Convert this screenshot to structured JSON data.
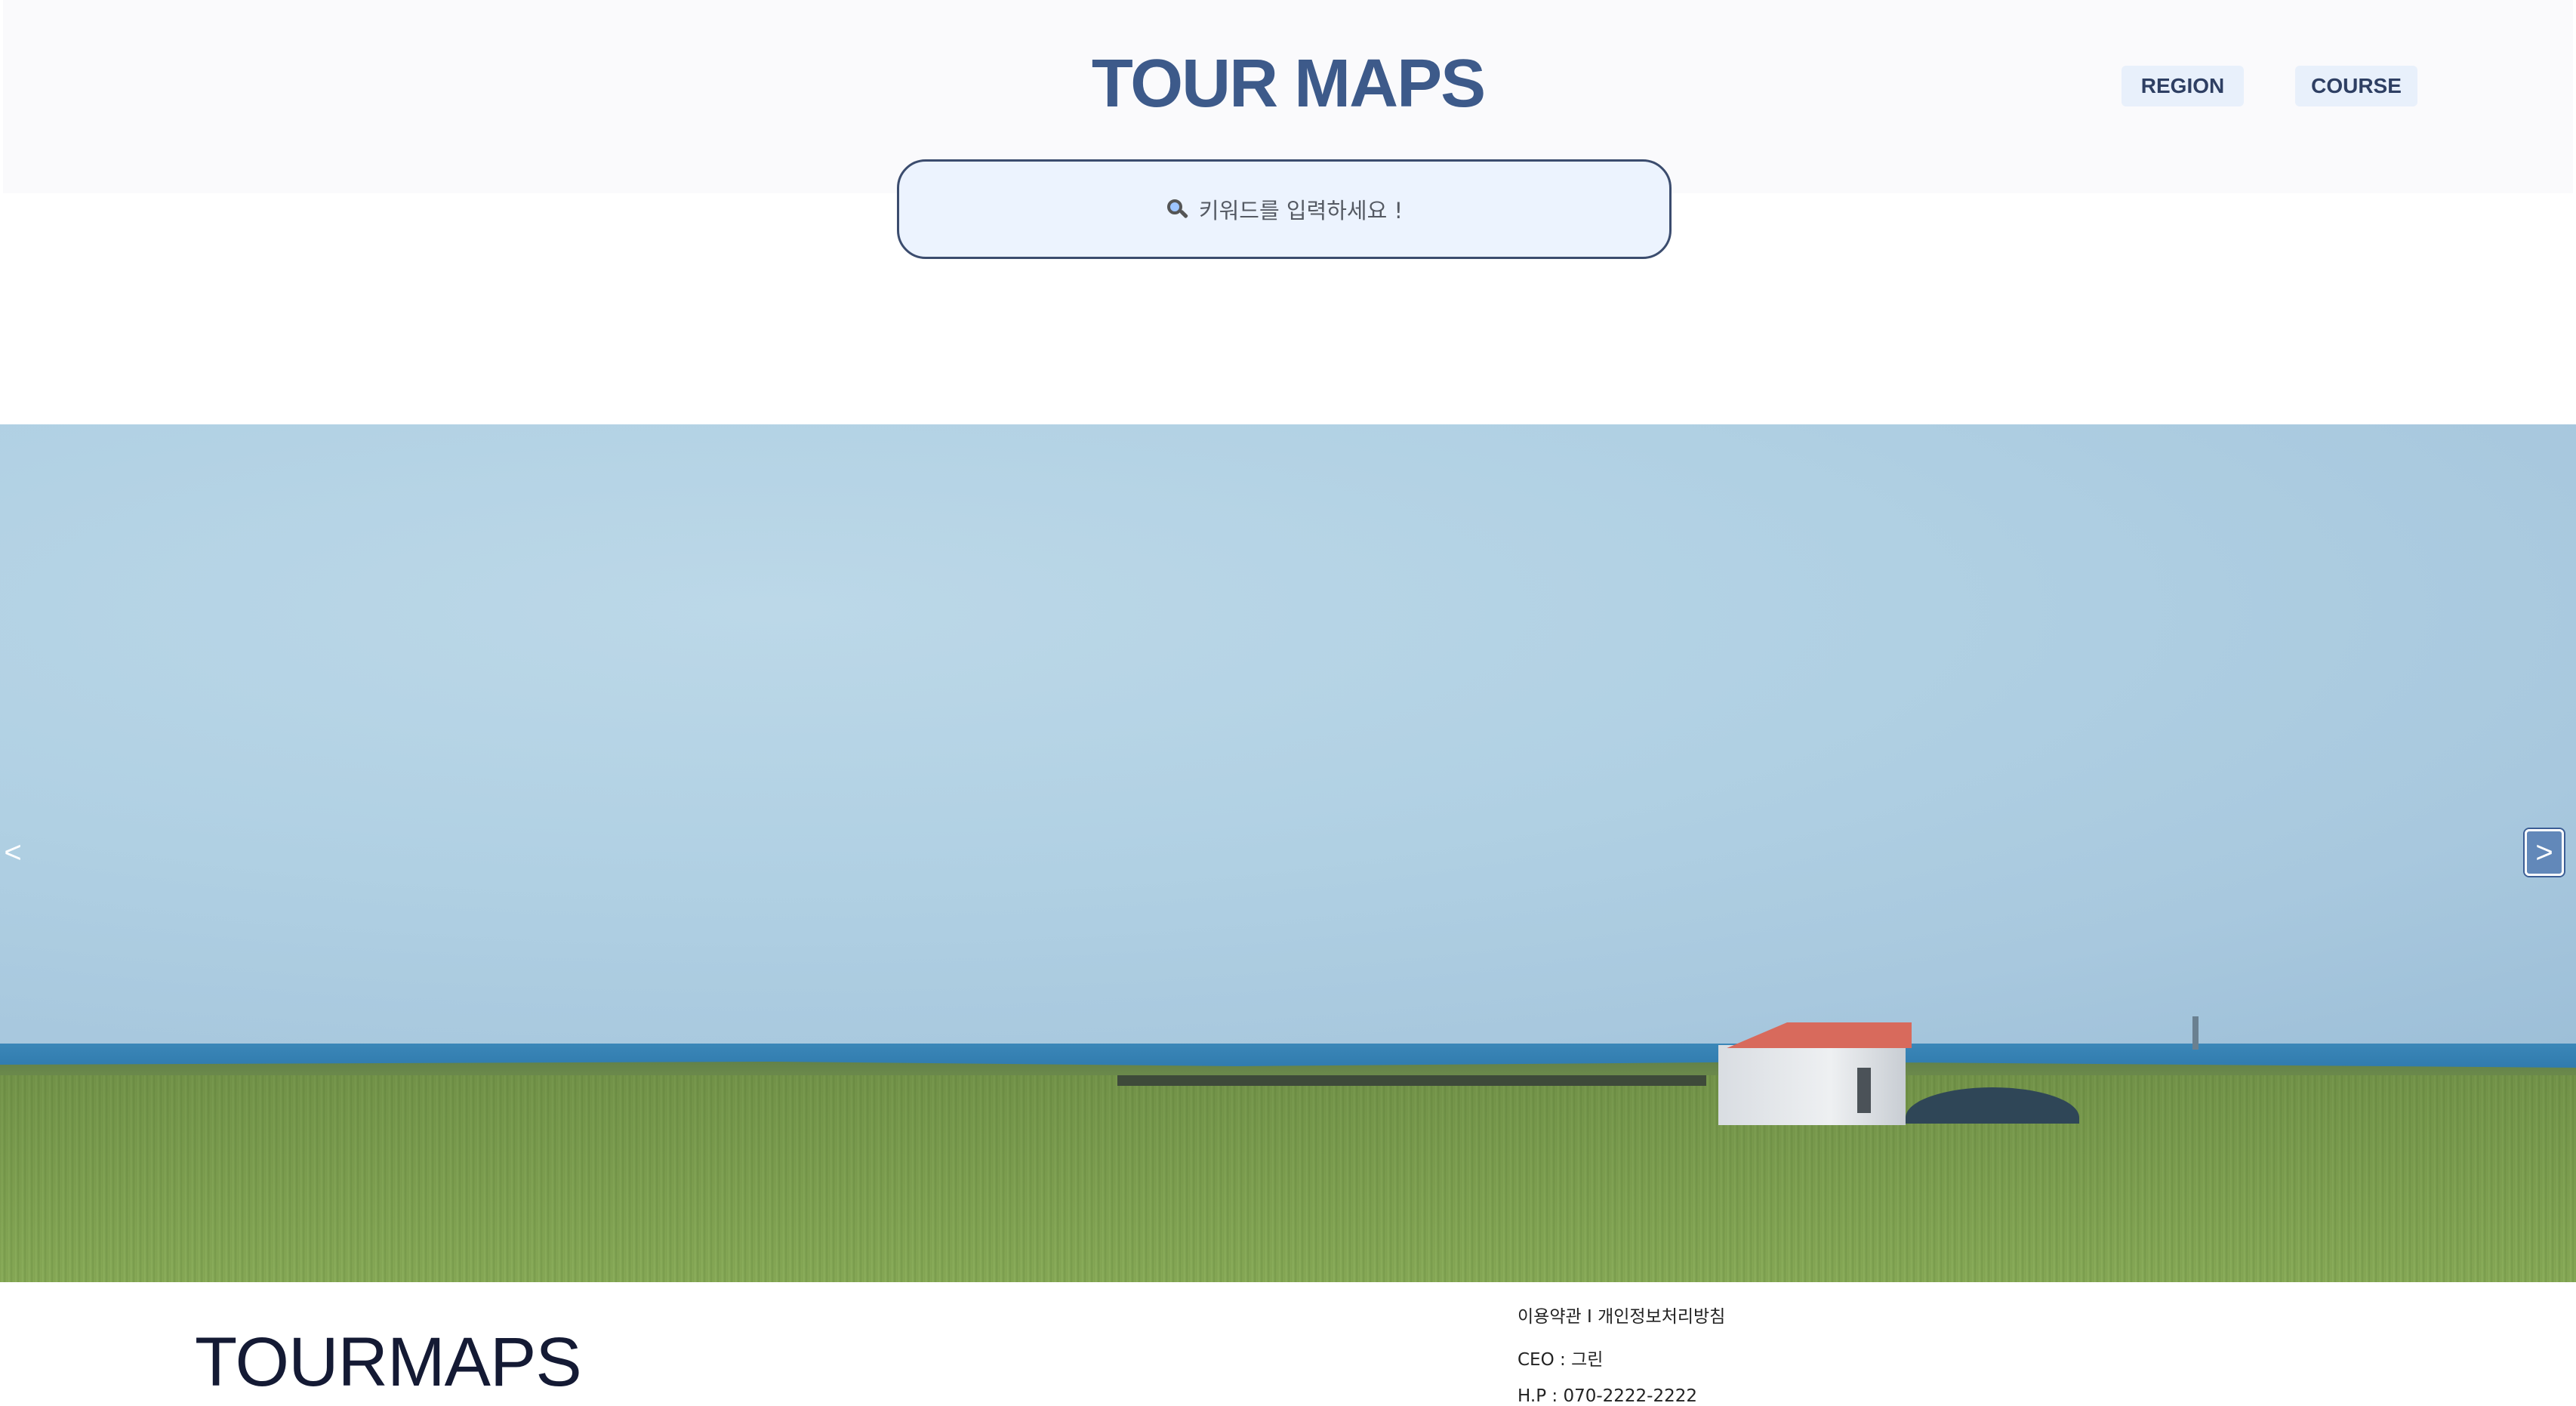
{
  "header": {
    "logo": "TOUR MAPS",
    "nav": {
      "region_label": "REGION",
      "course_label": "COURSE"
    }
  },
  "search": {
    "icon": "search-icon",
    "placeholder": "키워드를 입력하세요 !"
  },
  "hero": {
    "prev_label": "<",
    "next_label": ">"
  },
  "footer": {
    "logo": "TOURMAPS",
    "terms_label": "이용약관",
    "separator": "I",
    "privacy_label": "개인정보처리방침",
    "ceo": "CEO : 그린",
    "hp": "H.P : 070-2222-2222"
  },
  "colors": {
    "brand": "#3d5a8a",
    "nav_bg": "#e8f0fb",
    "search_bg": "#ecf3fe",
    "search_border": "#3b4c6e"
  }
}
